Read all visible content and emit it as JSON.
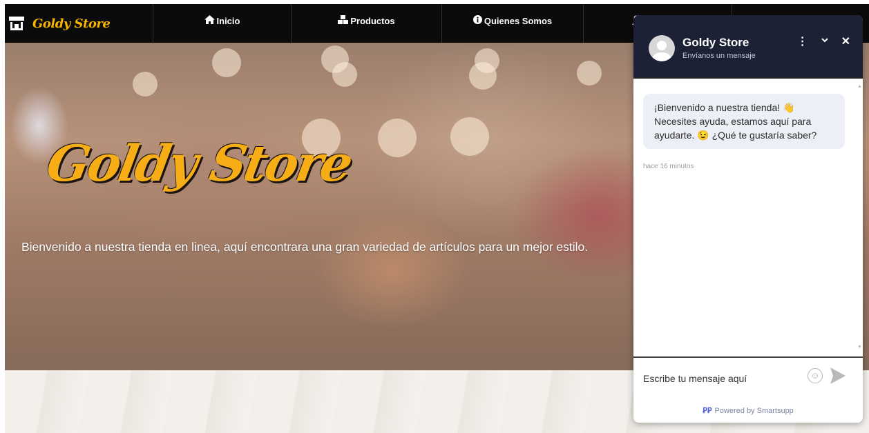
{
  "navbar": {
    "brand": "Goldy Store",
    "items": [
      {
        "label": "Inicio",
        "icon": "home-icon"
      },
      {
        "label": "Productos",
        "icon": "cubes-icon"
      },
      {
        "label": "Quienes Somos",
        "icon": "info-circle-icon"
      },
      {
        "label": "",
        "icon": "user-icon"
      }
    ]
  },
  "hero": {
    "logo_text": "Goldy Store",
    "tagline": "Bienvenido a nuestra tienda en linea, aquí encontrara una gran variedad de artículos para un mejor estilo."
  },
  "chat": {
    "title": "Goldy Store",
    "subtitle": "Envíanos un mensaje",
    "message": "¡Bienvenido a nuestra tienda! 👋 Necesites ayuda, estamos aquí para ayudarte. 😉 ¿Qué te gustaría saber?",
    "message_time": "hace 16 minutos",
    "input_placeholder": "Escribe tu mensaje aquí",
    "powered_by": "Powered by Smartsupp"
  },
  "colors": {
    "navbar_bg": "#0b0b0b",
    "brand_gold": "#f6ad16",
    "chat_header_bg": "#1c2135",
    "bubble_bg": "#edeff6"
  }
}
